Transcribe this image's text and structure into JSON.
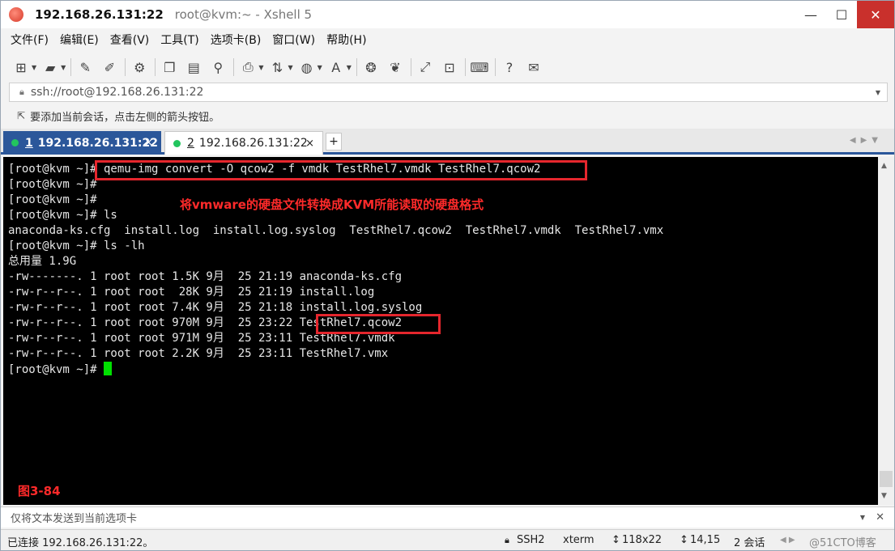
{
  "window": {
    "host": "192.168.26.131:22",
    "title_rest": "root@kvm:~ - Xshell 5",
    "min_glyph": "—",
    "max_glyph": "☐",
    "close_glyph": "✕"
  },
  "menu": [
    "文件(F)",
    "编辑(E)",
    "查看(V)",
    "工具(T)",
    "选项卡(B)",
    "窗口(W)",
    "帮助(H)"
  ],
  "address": {
    "value": "ssh://root@192.168.26.131:22"
  },
  "hint": {
    "text": "要添加当前会话，点击左侧的箭头按钮。"
  },
  "tabs": [
    {
      "num": "1",
      "label": "192.168.26.131:22",
      "close": "×"
    },
    {
      "num": "2",
      "label": "192.168.26.131:22",
      "close": "×"
    }
  ],
  "tab_add": "+",
  "terminal": {
    "lines": [
      "[root@kvm ~]# qemu-img convert -O qcow2 -f vmdk TestRhel7.vmdk TestRhel7.qcow2",
      "[root@kvm ~]#",
      "[root@kvm ~]#",
      "[root@kvm ~]# ls",
      "anaconda-ks.cfg  install.log  install.log.syslog  TestRhel7.qcow2  TestRhel7.vmdk  TestRhel7.vmx",
      "[root@kvm ~]# ls -lh",
      "总用量 1.9G",
      "-rw-------. 1 root root 1.5K 9月  25 21:19 anaconda-ks.cfg",
      "-rw-r--r--. 1 root root  28K 9月  25 21:19 install.log",
      "-rw-r--r--. 1 root root 7.4K 9月  25 21:18 install.log.syslog",
      "-rw-r--r--. 1 root root 970M 9月  25 23:22 TestRhel7.qcow2",
      "-rw-r--r--. 1 root root 971M 9月  25 23:11 TestRhel7.vmdk",
      "-rw-r--r--. 1 root root 2.2K 9月  25 23:11 TestRhel7.vmx"
    ],
    "prompt": "[root@kvm ~]# "
  },
  "annotation": "将vmware的硬盘文件转换成KVM所能读取的硬盘格式",
  "figure_label": "图3-84",
  "sendbar": {
    "text": "仅将文本发送到当前选项卡"
  },
  "status": {
    "connected": "已连接 192.168.26.131:22。",
    "protocol": "SSH2",
    "term": "xterm",
    "size": "118x22",
    "pos": "14,15",
    "sessions": "2 会话",
    "watermark": "@51CTO博客"
  },
  "colors": {
    "accent": "#2b579a",
    "highlight": "#e5262d",
    "cursor": "#00e000"
  }
}
